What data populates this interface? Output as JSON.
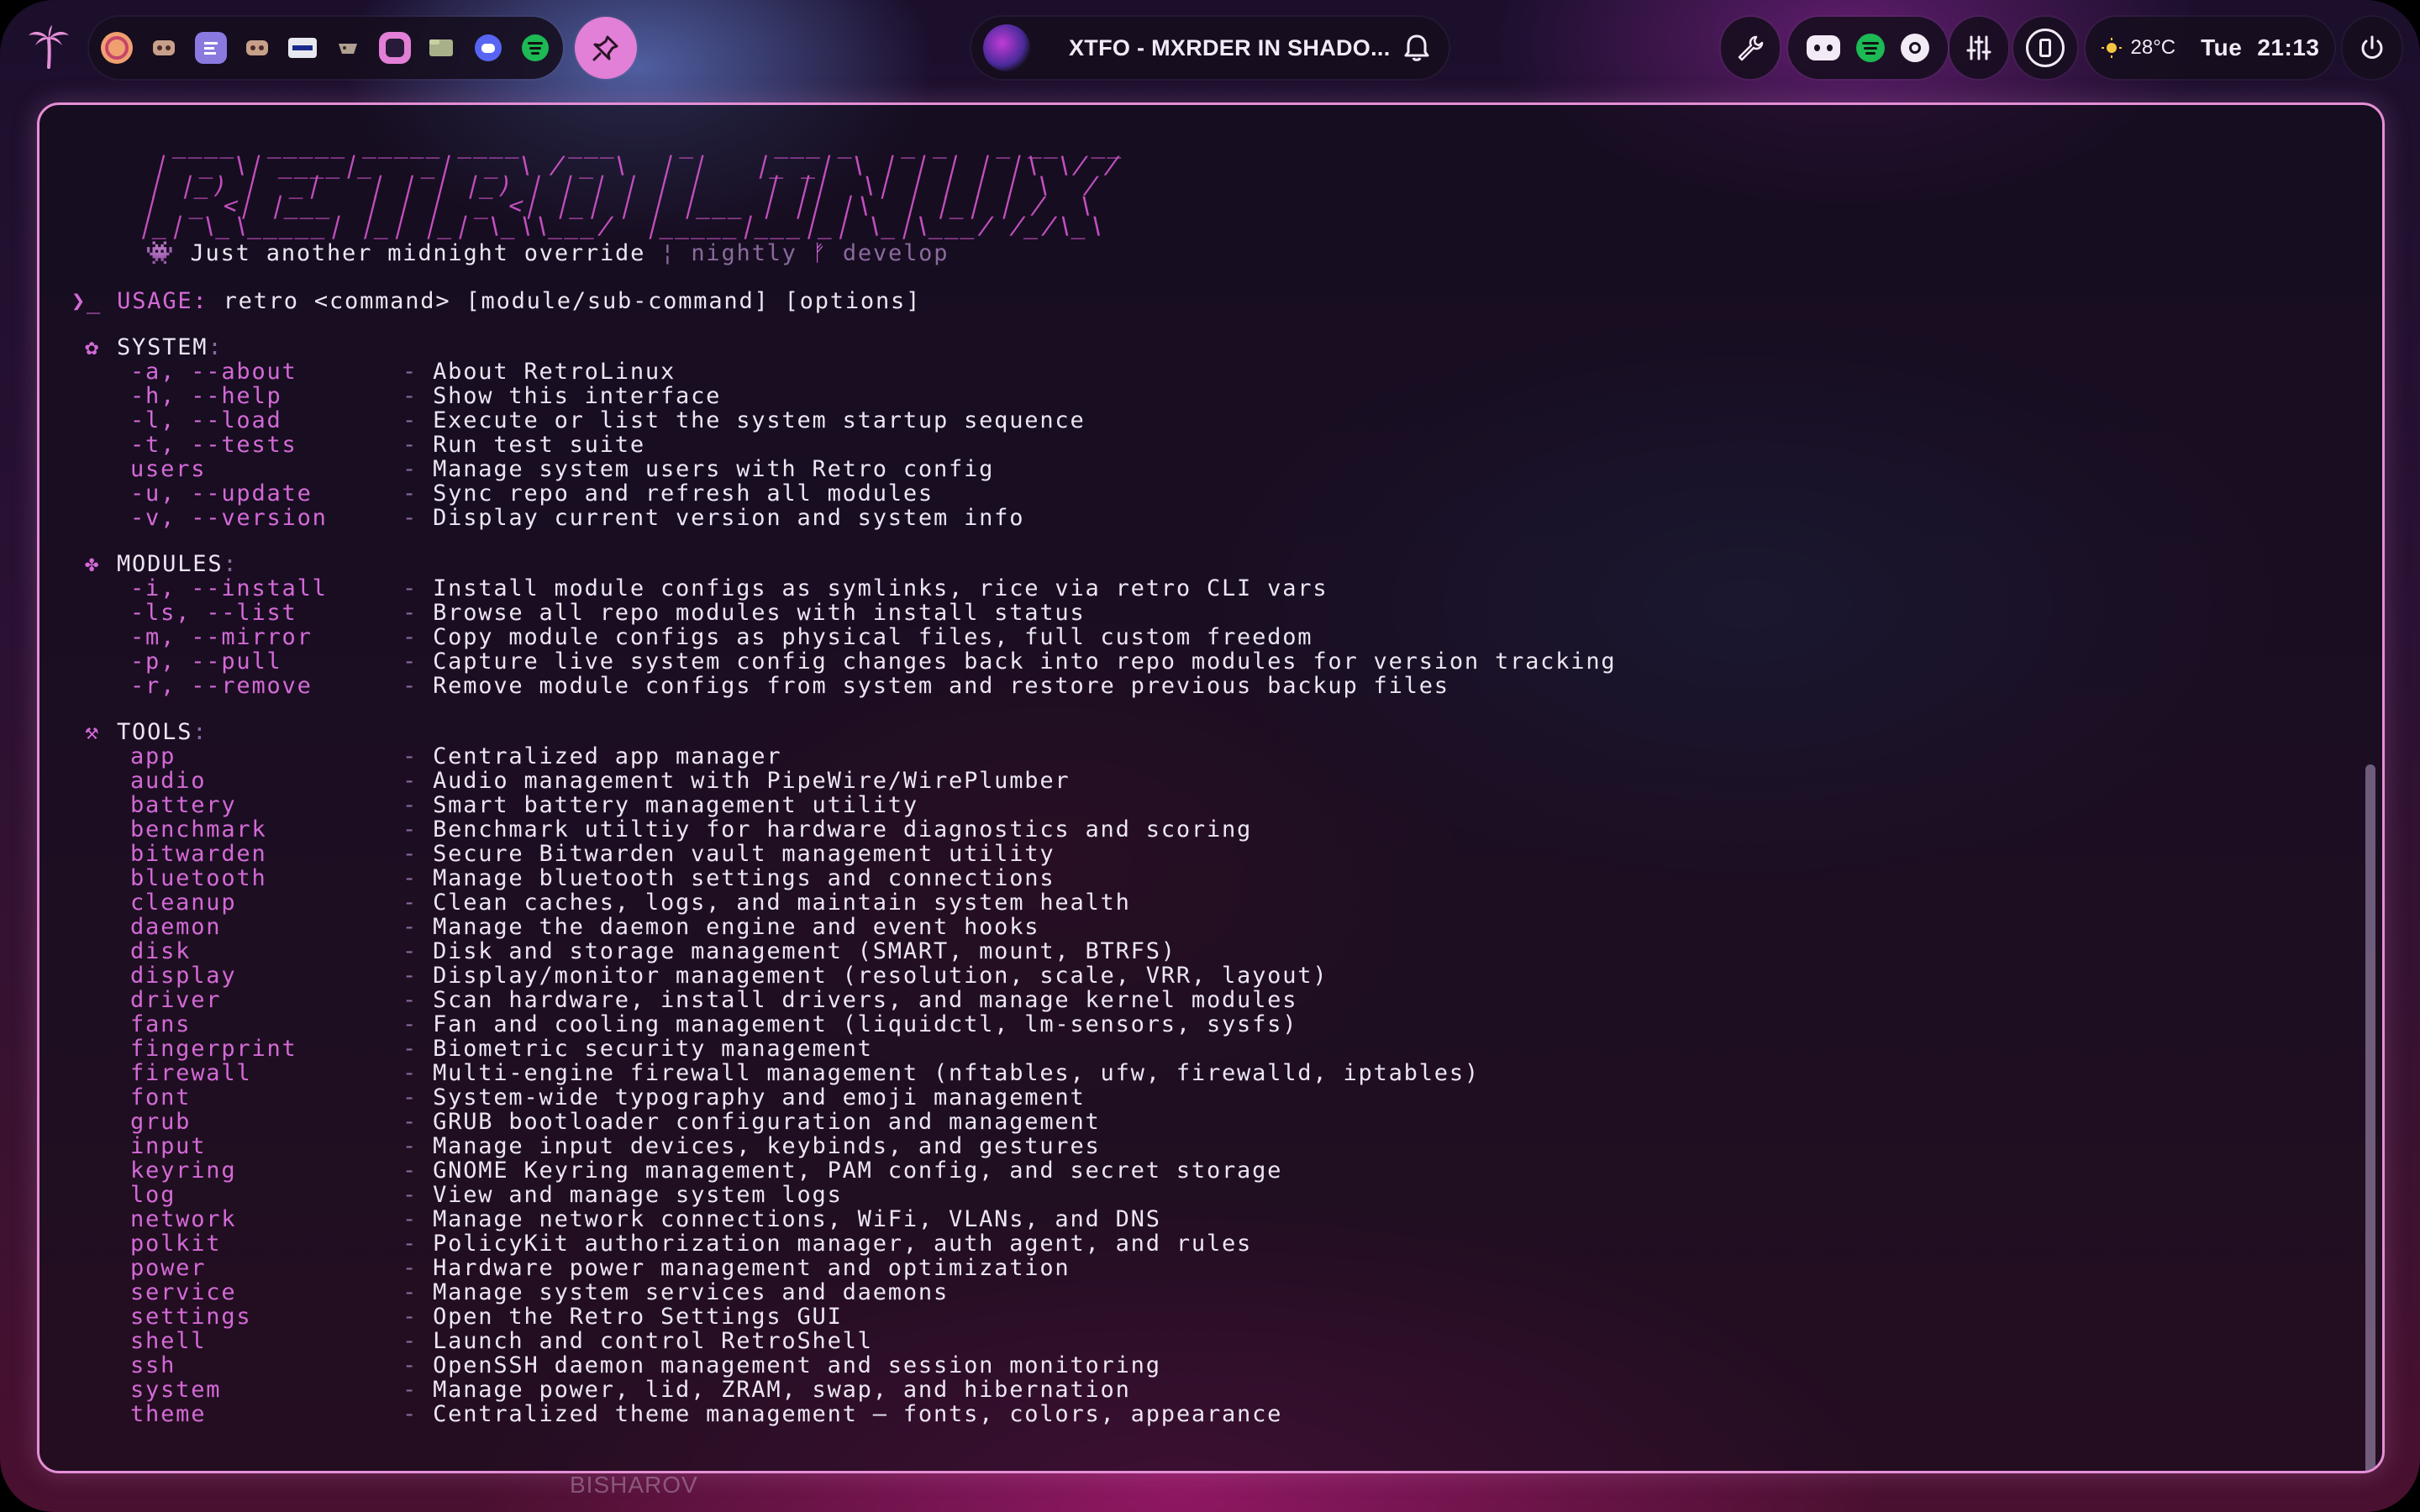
{
  "topbar": {
    "media_title": "XTFO - MXRDER IN SHADO...",
    "weather": "28°C",
    "day": "Tue",
    "time": "21:13"
  },
  "terminal": {
    "ascii_logo": "   ____  _____ _____ ____   ___    _     ___ _   _ _   _ __  __\n  |  _ \\| ____|_   _|  _ \\ / _ \\  | |   |_ _| \\ | | | | |\\ \\/ /\n  | |_) |  _|   | | | |_) | | | | | |    | ||  \\| | | | | \\  / \n  |  _ <| |___  | | |  _ <| |_| | | |___ | || |\\  | |_| | /  \\ \n  |_| \\_\\_____| |_| |_| \\_\\\\___/  |_____|___|_| \\_|\\___/ /_/\\_\\",
    "tagline": "Just another midnight override",
    "separator": "¦",
    "channel": "nightly",
    "branch": "develop",
    "usage_label": "USAGE:",
    "usage_text": "retro <command> [module/sub-command] [options]",
    "sections": [
      {
        "title": "SYSTEM",
        "rows": [
          {
            "flag": "-a, --about",
            "desc": "About RetroLinux"
          },
          {
            "flag": "-h, --help",
            "desc": "Show this interface"
          },
          {
            "flag": "-l, --load",
            "desc": "Execute or list the system startup sequence"
          },
          {
            "flag": "-t, --tests",
            "desc": "Run test suite"
          },
          {
            "flag": "users",
            "desc": "Manage system users with Retro config"
          },
          {
            "flag": "-u, --update",
            "desc": "Sync repo and refresh all modules"
          },
          {
            "flag": "-v, --version",
            "desc": "Display current version and system info"
          }
        ]
      },
      {
        "title": "MODULES",
        "rows": [
          {
            "flag": "-i, --install",
            "desc": "Install module configs as symlinks, rice via retro CLI vars"
          },
          {
            "flag": "-ls, --list",
            "desc": "Browse all repo modules with install status"
          },
          {
            "flag": "-m, --mirror",
            "desc": "Copy module configs as physical files, full custom freedom"
          },
          {
            "flag": "-p, --pull",
            "desc": "Capture live system config changes back into repo modules for version tracking"
          },
          {
            "flag": "-r, --remove",
            "desc": "Remove module configs from system and restore previous backup files"
          }
        ]
      },
      {
        "title": "TOOLS",
        "rows": [
          {
            "flag": "app",
            "desc": "Centralized app manager"
          },
          {
            "flag": "audio",
            "desc": "Audio management with PipeWire/WirePlumber"
          },
          {
            "flag": "battery",
            "desc": "Smart battery management utility"
          },
          {
            "flag": "benchmark",
            "desc": "Benchmark utiltiy for hardware diagnostics and scoring"
          },
          {
            "flag": "bitwarden",
            "desc": "Secure Bitwarden vault management utility"
          },
          {
            "flag": "bluetooth",
            "desc": "Manage bluetooth settings and connections"
          },
          {
            "flag": "cleanup",
            "desc": "Clean caches, logs, and maintain system health"
          },
          {
            "flag": "daemon",
            "desc": "Manage the daemon engine and event hooks"
          },
          {
            "flag": "disk",
            "desc": "Disk and storage management (SMART, mount, BTRFS)"
          },
          {
            "flag": "display",
            "desc": "Display/monitor management (resolution, scale, VRR, layout)"
          },
          {
            "flag": "driver",
            "desc": "Scan hardware, install drivers, and manage kernel modules"
          },
          {
            "flag": "fans",
            "desc": "Fan and cooling management (liquidctl, lm-sensors, sysfs)"
          },
          {
            "flag": "fingerprint",
            "desc": "Biometric security management"
          },
          {
            "flag": "firewall",
            "desc": "Multi-engine firewall management (nftables, ufw, firewalld, iptables)"
          },
          {
            "flag": "font",
            "desc": "System-wide typography and emoji management"
          },
          {
            "flag": "grub",
            "desc": "GRUB bootloader configuration and management"
          },
          {
            "flag": "input",
            "desc": "Manage input devices, keybinds, and gestures"
          },
          {
            "flag": "keyring",
            "desc": "GNOME Keyring management, PAM config, and secret storage"
          },
          {
            "flag": "log",
            "desc": "View and manage system logs"
          },
          {
            "flag": "network",
            "desc": "Manage network connections, WiFi, VLANs, and DNS"
          },
          {
            "flag": "polkit",
            "desc": "PolicyKit authorization manager, auth agent, and rules"
          },
          {
            "flag": "power",
            "desc": "Hardware power management and optimization"
          },
          {
            "flag": "service",
            "desc": "Manage system services and daemons"
          },
          {
            "flag": "settings",
            "desc": "Open the Retro Settings GUI"
          },
          {
            "flag": "shell",
            "desc": "Launch and control RetroShell"
          },
          {
            "flag": "ssh",
            "desc": "OpenSSH daemon management and session monitoring"
          },
          {
            "flag": "system",
            "desc": "Manage power, lid, ZRAM, swap, and hibernation"
          },
          {
            "flag": "theme",
            "desc": "Centralized theme management — fonts, colors, appearance"
          }
        ]
      }
    ]
  },
  "wallpaper": {
    "signature": "BISHAROV"
  },
  "colors": {
    "accent": "#d36ad6",
    "border": "#e58fd6",
    "text": "#ece6f2",
    "dim": "#8a6a9c"
  }
}
